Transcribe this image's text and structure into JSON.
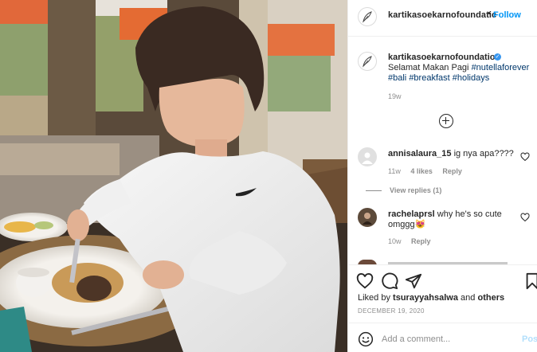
{
  "post": {
    "username": "kartikasoekarnofoundatic",
    "follow_dot": "•",
    "follow_label": "Follow"
  },
  "caption": {
    "username": "kartikasoekarnofoundation",
    "verified_icon": "verified-badge-icon",
    "text_plain": "Selamat Makan Pagi",
    "tags_line1": "#nutellaforever",
    "tags_line2": [
      "#bali",
      "#breakfast",
      "#holidays"
    ],
    "time": "19w"
  },
  "comments": [
    {
      "username": "annisalaura_15",
      "text": "ig nya apa????",
      "time": "11w",
      "likes": "4 likes",
      "reply": "Reply",
      "view_replies": "View replies (1)"
    },
    {
      "username": "rachelaprsl",
      "text": "why he's so cute omggg",
      "emoji": "😻",
      "time": "10w",
      "reply": "Reply"
    }
  ],
  "actions": {
    "liked_by_prefix": "Liked by",
    "liked_by_user": "tsurayyahsalwa",
    "liked_by_suffix": "and",
    "liked_by_others": "others",
    "date": "DECEMBER 19, 2020"
  },
  "add_comment": {
    "placeholder": "Add a comment...",
    "post_label": "Post"
  },
  "colors": {
    "link_blue": "#0095f6",
    "hashtag": "#00376b",
    "muted": "#8e8e8e",
    "border": "#efefef"
  }
}
